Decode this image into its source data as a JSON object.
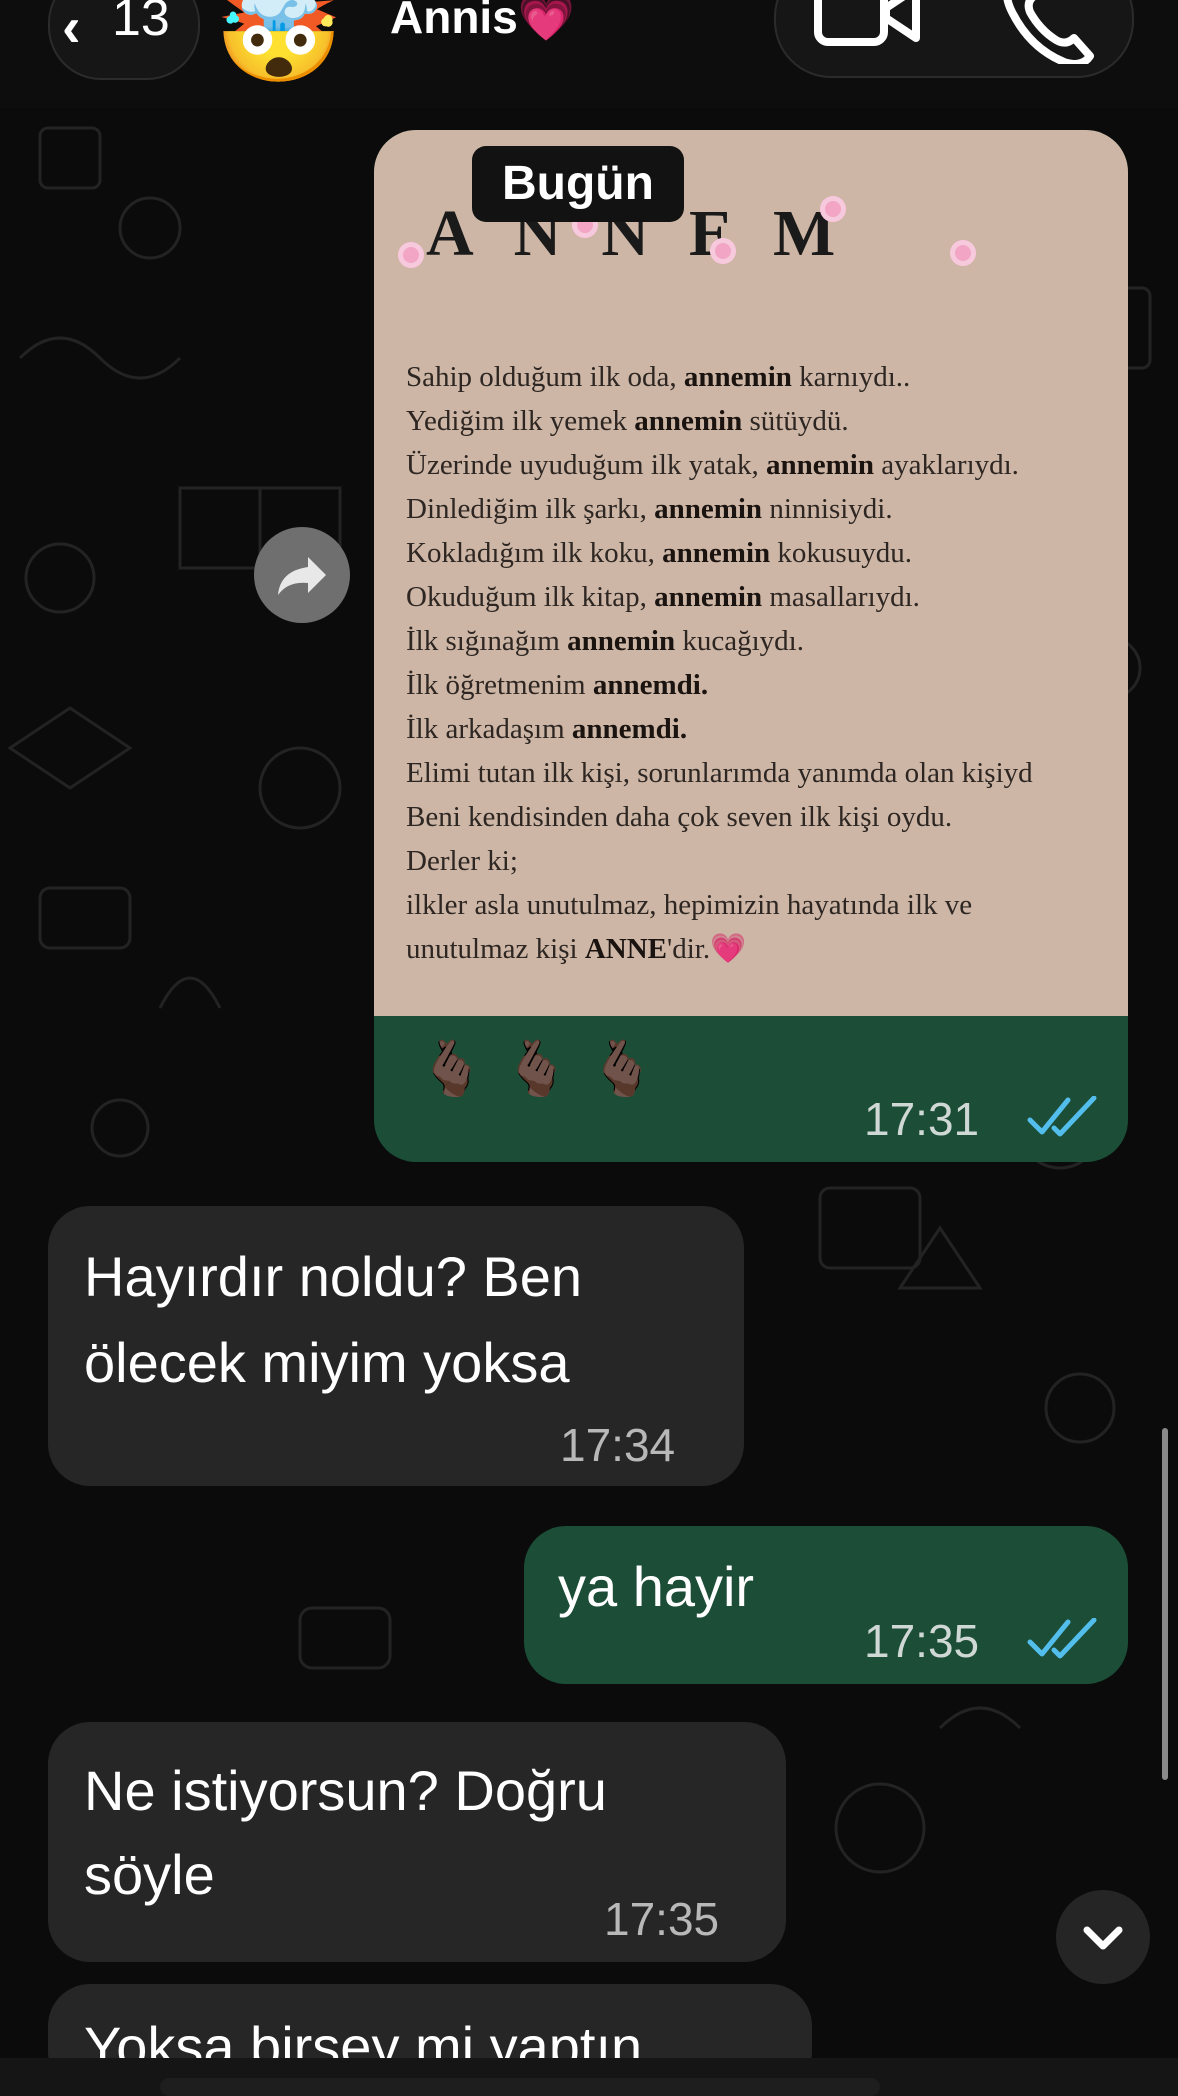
{
  "header": {
    "back_count": "13",
    "avatar_emoji": "🤯",
    "contact_name": "Annis💗"
  },
  "date_chip": "Bugün",
  "forwarded_image": {
    "title_letters": [
      "A",
      "N",
      "N",
      "E",
      "M"
    ],
    "poem_lines": [
      [
        {
          "t": "Sahip olduğum ilk oda, "
        },
        {
          "b": "annemin"
        },
        {
          "t": " karnıydı.."
        }
      ],
      [
        {
          "t": "Yediğim ilk yemek "
        },
        {
          "b": "annemin"
        },
        {
          "t": " sütüydü."
        }
      ],
      [
        {
          "t": "Üzerinde uyuduğum ilk yatak, "
        },
        {
          "b": "annemin"
        },
        {
          "t": " ayaklarıydı."
        }
      ],
      [
        {
          "t": "Dinlediğim ilk şarkı, "
        },
        {
          "b": "annemin"
        },
        {
          "t": " ninnisiydi."
        }
      ],
      [
        {
          "t": "Kokladığım ilk koku, "
        },
        {
          "b": "annemin"
        },
        {
          "t": " kokusuydu."
        }
      ],
      [
        {
          "t": "Okuduğum ilk kitap, "
        },
        {
          "b": "annemin"
        },
        {
          "t": " masallarıydı."
        }
      ],
      [
        {
          "t": "İlk sığınağım "
        },
        {
          "b": "annemin"
        },
        {
          "t": " kucağıydı."
        }
      ],
      [
        {
          "t": "İlk öğretmenim "
        },
        {
          "b": "annemdi."
        }
      ],
      [
        {
          "t": "İlk arkadaşım "
        },
        {
          "b": "annemdi."
        }
      ],
      [
        {
          "t": "Elimi tutan ilk kişi, sorunlarımda yanımda olan kişiyd"
        }
      ],
      [
        {
          "t": "Beni kendisinden daha çok seven ilk kişi oydu."
        }
      ],
      [
        {
          "t": "Derler ki;"
        }
      ],
      [
        {
          "t": "ilkler asla unutulmaz, hepimizin hayatında ilk ve"
        }
      ],
      [
        {
          "t": "unutulmaz kişi "
        },
        {
          "b": "ANNE"
        },
        {
          "t": "'dir."
        },
        {
          "h": "💗"
        }
      ]
    ],
    "caption_emojis": "🫰🏿🫰🏿🫰🏿",
    "time": "17:31"
  },
  "messages": [
    {
      "side": "in",
      "lines": [
        "Hayırdır noldu? Ben",
        "ölecek miyim yoksa"
      ],
      "time": "17:34"
    },
    {
      "side": "out",
      "lines": [
        "ya hayir"
      ],
      "time": "17:35"
    },
    {
      "side": "in",
      "lines": [
        "Ne istiyorsun? Doğru",
        "söyle"
      ],
      "time": "17:35"
    },
    {
      "side": "in",
      "lines": [
        "Yoksa birsey mi yaptın"
      ],
      "time": ""
    }
  ],
  "colors": {
    "outgoing_bubble": "#1b4d37",
    "incoming_bubble": "#262626",
    "read_ticks": "#53bdeb"
  }
}
